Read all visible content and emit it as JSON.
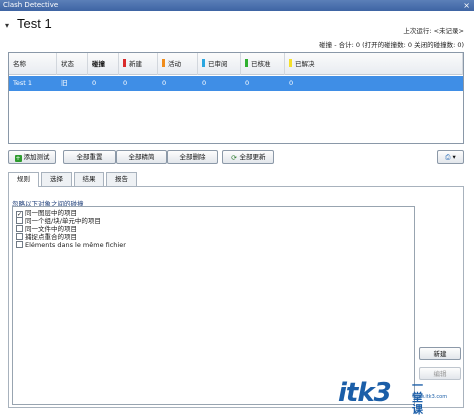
{
  "window": {
    "title": "Clash Detective",
    "close_glyph": "×"
  },
  "test_header": {
    "collapse_glyph": "▾",
    "name": "Test 1",
    "last_run": "上次运行: <未记录>",
    "summary": "碰撞 - 合计: 0 (打开的碰撞数: 0 关闭的碰撞数: 0)"
  },
  "grid": {
    "columns": [
      {
        "label": "名称"
      },
      {
        "label": "状态"
      },
      {
        "label": "碰撞",
        "bold": true
      },
      {
        "label": "新建",
        "color": "#d92b2b"
      },
      {
        "label": "活动",
        "color": "#f08c1a"
      },
      {
        "label": "已审阅",
        "color": "#2aa6e0"
      },
      {
        "label": "已核准",
        "color": "#2fb02f"
      },
      {
        "label": "已解决",
        "color": "#f5e02a"
      }
    ],
    "rows": [
      {
        "cells": [
          "Test 1",
          "旧",
          "0",
          "0",
          "0",
          "0",
          "0",
          "0"
        ]
      }
    ]
  },
  "toolbar": {
    "add_test": "添加测试",
    "reset_all": "全部重置",
    "compact_all": "全部精简",
    "delete_all": "全部删除",
    "update_all": "全部更新"
  },
  "tabs": [
    {
      "label": "规则",
      "active": true
    },
    {
      "label": "选择"
    },
    {
      "label": "结果"
    },
    {
      "label": "报告"
    }
  ],
  "rules": {
    "heading": "忽略以下对象之间的碰撞",
    "items": [
      {
        "label": "同一图层中的项目",
        "checked": true
      },
      {
        "label": "同一个组/块/单元中的项目",
        "checked": false
      },
      {
        "label": "同一文件中的项目",
        "checked": false
      },
      {
        "label": "捕捉点重合的项目",
        "checked": false
      },
      {
        "label": "Eléments dans le même fichier",
        "checked": false
      }
    ],
    "new_button": "新建",
    "edit_button": "编辑",
    "check_glyph": "✓"
  },
  "watermark": {
    "big": "itk3",
    "small": "一堂课",
    "url": "www.itk3.com"
  }
}
